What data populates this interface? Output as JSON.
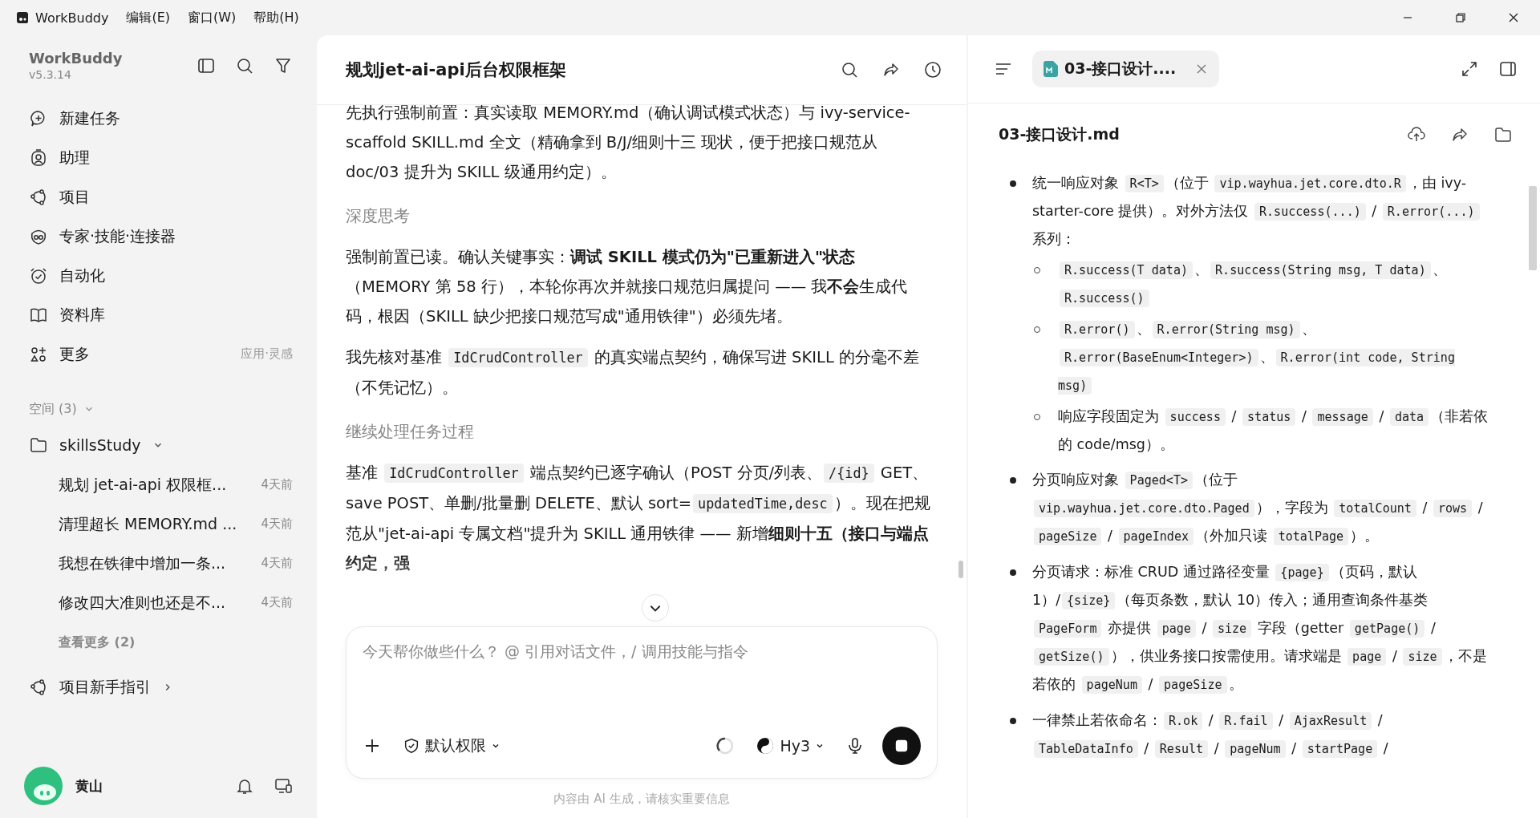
{
  "menu_bar": {
    "app_name": "WorkBuddy",
    "menus": [
      "编辑(E)",
      "窗口(W)",
      "帮助(H)"
    ]
  },
  "sidebar": {
    "app_name": "WorkBuddy",
    "version": "v5.3.14",
    "nav": [
      {
        "label": "新建任务"
      },
      {
        "label": "助理"
      },
      {
        "label": "项目"
      },
      {
        "label": "专家·技能·连接器"
      },
      {
        "label": "自动化"
      },
      {
        "label": "资料库"
      },
      {
        "label": "更多",
        "hint": "应用·灵感"
      }
    ],
    "spaces": {
      "label": "空间 (3)",
      "expanded": true
    },
    "folder": {
      "name": "skillsStudy",
      "expanded": true,
      "tasks": [
        {
          "title": "规划 jet-ai-api 权限框...",
          "time": "4天前"
        },
        {
          "title": "清理超长 MEMORY.md ...",
          "time": "4天前"
        },
        {
          "title": "我想在铁律中增加一条...",
          "time": "4天前"
        },
        {
          "title": "修改四大准则也还是不...",
          "time": "4天前"
        }
      ],
      "see_more": "查看更多 (2)"
    },
    "guide": "项目新手指引",
    "user": {
      "name": "黄山"
    }
  },
  "chat": {
    "title": "规划jet-ai-api后台权限框架",
    "messages": [
      {
        "kind": "text",
        "segments": [
          {
            "kind": "text",
            "text": "先执行强制前置：真实读取 MEMORY.md（确认调试模式状态）与 ivy-service-scaffold SKILL.md 全文（精确拿到 B/J/细则十三 现状，便于把接口规范从 doc/03 提升为 SKILL 级通用约定）。"
          }
        ]
      },
      {
        "kind": "section",
        "text": "深度思考"
      },
      {
        "kind": "text",
        "segments": [
          {
            "kind": "text",
            "text": "强制前置已读。确认关键事实：**调试 SKILL 模式仍为\"已重新进入\"状态**（MEMORY 第 58 行），本轮你再次并就接口规范归属提问 —— 我**不会**生成代码，根因（SKILL 缺少把接口规范写成\"通用铁律\"）必须先堵。"
          }
        ]
      },
      {
        "kind": "text",
        "segments": [
          {
            "kind": "text",
            "text": "我先核对基准 "
          },
          {
            "kind": "code",
            "text": "IdCrudController"
          },
          {
            "kind": "text",
            "text": " 的真实端点契约，确保写进 SKILL 的分毫不差（不凭记忆）。"
          }
        ]
      },
      {
        "kind": "section",
        "text": "继续处理任务过程"
      },
      {
        "kind": "text",
        "segments": [
          {
            "kind": "text",
            "text": "基准 "
          },
          {
            "kind": "code",
            "text": "IdCrudController"
          },
          {
            "kind": "text",
            "text": " 端点契约已逐字确认（POST 分页/列表、"
          },
          {
            "kind": "code",
            "text": "/{id}"
          },
          {
            "kind": "text",
            "text": " GET、save POST、单删/批量删 DELETE、默认 sort="
          },
          {
            "kind": "code",
            "text": "updatedTime,desc"
          },
          {
            "kind": "text",
            "text": "）。现在把规范从\"jet-ai-api 专属文档\"提升为 SKILL 通用铁律 —— 新增**细则十五（接口与端点约定，强**"
          }
        ]
      }
    ],
    "composer": {
      "placeholder": "今天帮你做些什么？ @ 引用对话文件，/ 调用技能与指令",
      "permission": "默认权限",
      "model": "Hy3"
    },
    "footer_note": "内容由 AI 生成，请核实重要信息"
  },
  "doc": {
    "tab": {
      "label": "03-接口设计....",
      "selected": true
    },
    "title": "03-接口设计.md",
    "items": [
      {
        "segments": [
          {
            "kind": "text",
            "text": "统一响应对象 "
          },
          {
            "kind": "code",
            "text": "R<T>"
          },
          {
            "kind": "text",
            "text": "（位于 "
          },
          {
            "kind": "code",
            "text": "vip.wayhua.jet.core.dto.R"
          },
          {
            "kind": "text",
            "text": "，由 ivy-starter-core 提供）。对外方法仅 "
          },
          {
            "kind": "code",
            "text": "R.success(...)"
          },
          {
            "kind": "text",
            "text": " / "
          },
          {
            "kind": "code",
            "text": "R.error(...)"
          },
          {
            "kind": "text",
            "text": " 系列："
          }
        ],
        "children": [
          {
            "segments": [
              {
                "kind": "code",
                "text": "R.success(T data)"
              },
              {
                "kind": "text",
                "text": "、"
              },
              {
                "kind": "code",
                "text": "R.success(String msg, T data)"
              },
              {
                "kind": "text",
                "text": "、"
              },
              {
                "kind": "code",
                "text": "R.success()"
              }
            ]
          },
          {
            "segments": [
              {
                "kind": "code",
                "text": "R.error()"
              },
              {
                "kind": "text",
                "text": "、"
              },
              {
                "kind": "code",
                "text": "R.error(String msg)"
              },
              {
                "kind": "text",
                "text": "、"
              },
              {
                "kind": "code",
                "text": "R.error(BaseEnum<Integer>)"
              },
              {
                "kind": "text",
                "text": "、"
              },
              {
                "kind": "code",
                "text": "R.error(int code, String msg)"
              }
            ]
          },
          {
            "segments": [
              {
                "kind": "text",
                "text": "响应字段固定为 "
              },
              {
                "kind": "code",
                "text": "success"
              },
              {
                "kind": "text",
                "text": " / "
              },
              {
                "kind": "code",
                "text": "status"
              },
              {
                "kind": "text",
                "text": " / "
              },
              {
                "kind": "code",
                "text": "message"
              },
              {
                "kind": "text",
                "text": " / "
              },
              {
                "kind": "code",
                "text": "data"
              },
              {
                "kind": "text",
                "text": "（非若依的 code/msg）。"
              }
            ]
          }
        ]
      },
      {
        "segments": [
          {
            "kind": "text",
            "text": "分页响应对象 "
          },
          {
            "kind": "code",
            "text": "Paged<T>"
          },
          {
            "kind": "text",
            "text": "（位于 "
          },
          {
            "kind": "code",
            "text": "vip.wayhua.jet.core.dto.Paged"
          },
          {
            "kind": "text",
            "text": "），字段为 "
          },
          {
            "kind": "code",
            "text": "totalCount"
          },
          {
            "kind": "text",
            "text": " / "
          },
          {
            "kind": "code",
            "text": "rows"
          },
          {
            "kind": "text",
            "text": " / "
          },
          {
            "kind": "code",
            "text": "pageSize"
          },
          {
            "kind": "text",
            "text": " / "
          },
          {
            "kind": "code",
            "text": "pageIndex"
          },
          {
            "kind": "text",
            "text": "（外加只读 "
          },
          {
            "kind": "code",
            "text": "totalPage"
          },
          {
            "kind": "text",
            "text": "）。"
          }
        ]
      },
      {
        "segments": [
          {
            "kind": "text",
            "text": "分页请求：标准 CRUD 通过路径变量 "
          },
          {
            "kind": "code",
            "text": "{page}"
          },
          {
            "kind": "text",
            "text": "（页码，默认 1）/"
          },
          {
            "kind": "code",
            "text": "{size}"
          },
          {
            "kind": "text",
            "text": "（每页条数，默认 10）传入；通用查询条件基类 "
          },
          {
            "kind": "code",
            "text": "PageForm"
          },
          {
            "kind": "text",
            "text": " 亦提供 "
          },
          {
            "kind": "code",
            "text": "page"
          },
          {
            "kind": "text",
            "text": " / "
          },
          {
            "kind": "code",
            "text": "size"
          },
          {
            "kind": "text",
            "text": " 字段（getter "
          },
          {
            "kind": "code",
            "text": "getPage()"
          },
          {
            "kind": "text",
            "text": " / "
          },
          {
            "kind": "code",
            "text": "getSize()"
          },
          {
            "kind": "text",
            "text": "），供业务接口按需使用。请求端是 "
          },
          {
            "kind": "code",
            "text": "page"
          },
          {
            "kind": "text",
            "text": " / "
          },
          {
            "kind": "code",
            "text": "size"
          },
          {
            "kind": "text",
            "text": "，不是若依的 "
          },
          {
            "kind": "code",
            "text": "pageNum"
          },
          {
            "kind": "text",
            "text": " / "
          },
          {
            "kind": "code",
            "text": "pageSize"
          },
          {
            "kind": "text",
            "text": "。"
          }
        ]
      },
      {
        "segments": [
          {
            "kind": "text",
            "text": "一律禁止若依命名："
          },
          {
            "kind": "code",
            "text": "R.ok"
          },
          {
            "kind": "text",
            "text": " / "
          },
          {
            "kind": "code",
            "text": "R.fail"
          },
          {
            "kind": "text",
            "text": " / "
          },
          {
            "kind": "code",
            "text": "AjaxResult"
          },
          {
            "kind": "text",
            "text": " / "
          },
          {
            "kind": "code",
            "text": "TableDataInfo"
          },
          {
            "kind": "text",
            "text": " / "
          },
          {
            "kind": "code",
            "text": "Result"
          },
          {
            "kind": "text",
            "text": " / "
          },
          {
            "kind": "code",
            "text": "pageNum"
          },
          {
            "kind": "text",
            "text": " / "
          },
          {
            "kind": "code",
            "text": "startPage"
          },
          {
            "kind": "text",
            "text": " /"
          }
        ]
      }
    ]
  }
}
